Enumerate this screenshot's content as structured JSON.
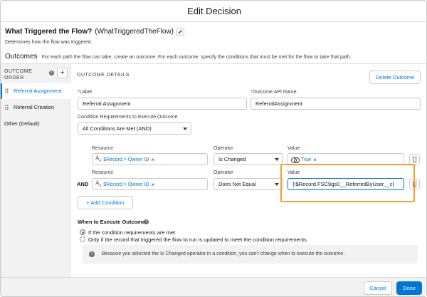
{
  "modal": {
    "title": "Edit Decision"
  },
  "element": {
    "label": "What Triggered the Flow?",
    "api_name": "(WhatTriggeredTheFlow)",
    "description": "Determines how the flow was triggered."
  },
  "outcomes": {
    "heading": "Outcomes",
    "subtext": "For each path the flow can take, create an outcome. For each outcome, specify the conditions that must be met for the flow to take that path."
  },
  "outcome_order": {
    "heading_line1": "OUTCOME",
    "heading_line2": "ORDER",
    "items": [
      {
        "label": "Referral Assignment",
        "active": true
      },
      {
        "label": "Referral Creation",
        "active": false
      },
      {
        "label": "Other (Default)",
        "active": false
      }
    ]
  },
  "details": {
    "heading": "OUTCOME DETAILS",
    "delete_label": "Delete Outcome",
    "label_field": {
      "label": "Label",
      "value": "Referral Assignment"
    },
    "api_field": {
      "label": "Outcome API Name",
      "value": "ReferralAssignment"
    },
    "requirements": {
      "label": "Condition Requirements to Execute Outcome",
      "value": "All Conditions Are Met (AND)"
    }
  },
  "conditions": [
    {
      "prefix": "",
      "resource_label": "Resource",
      "resource_value": "$Record > Owner ID",
      "operator_label": "Operator",
      "operator_value": "Is Changed",
      "value_label": "Value",
      "value_value": "True"
    },
    {
      "prefix": "AND",
      "resource_label": "Resource",
      "resource_value": "$Record > Owner ID",
      "operator_label": "Operator",
      "operator_value": "Does Not Equal",
      "value_label": "Value",
      "value_value": "{!$Record.FSC9gs0__ReferredByUser__c}"
    }
  ],
  "add_condition_label": "Add Condition",
  "when_execute": {
    "heading": "When to Execute Outcome",
    "options": [
      {
        "label": "If the condition requirements are met",
        "selected": true
      },
      {
        "label": "Only if the record that triggered the flow to run is updated to meet the condition requirements",
        "selected": false
      }
    ],
    "notice": "Because you selected the Is Changed operator in a condition, you can't change when to execute the outcome."
  },
  "footer": {
    "cancel_label": "Cancel",
    "done_label": "Done"
  },
  "colors": {
    "brand": "#0176d3",
    "highlight": "#f0a12c",
    "panel": "#f3f2f2"
  },
  "icons": [
    "pencil-icon",
    "info-icon",
    "add-icon",
    "grip-icon",
    "text-type-icon",
    "boolean-icon",
    "delete-icon",
    "chevron-down-icon"
  ]
}
